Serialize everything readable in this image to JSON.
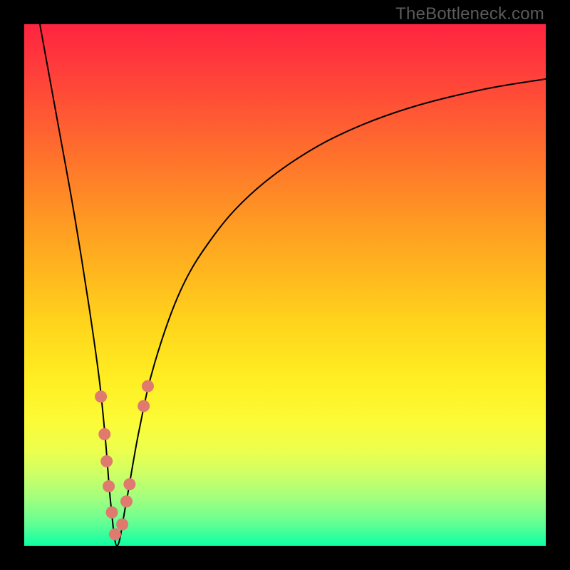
{
  "watermark": "TheBottleneck.com",
  "chart_data": {
    "type": "line",
    "title": "",
    "xlabel": "",
    "ylabel": "",
    "xlim": [
      0,
      100
    ],
    "ylim": [
      0,
      100
    ],
    "grid": false,
    "legend": false,
    "series": [
      {
        "name": "bottleneck-curve",
        "x": [
          3.0,
          5.0,
          7.0,
          9.0,
          11.0,
          13.0,
          14.5,
          15.6,
          16.6,
          17.8,
          19.5,
          22.0,
          25.0,
          30.0,
          36.0,
          43.0,
          52.0,
          62.0,
          74.0,
          88.0,
          100.0
        ],
        "y": [
          100.0,
          89.0,
          78.0,
          67.0,
          55.0,
          42.0,
          31.0,
          20.0,
          8.0,
          0.0,
          8.0,
          22.0,
          35.0,
          49.0,
          59.0,
          67.0,
          74.0,
          79.5,
          84.0,
          87.5,
          89.5
        ]
      }
    ],
    "markers": [
      {
        "name": "dot",
        "x": 14.7,
        "y": 28.6
      },
      {
        "name": "dot",
        "x": 15.4,
        "y": 21.4
      },
      {
        "name": "dot",
        "x": 15.8,
        "y": 16.2
      },
      {
        "name": "dot",
        "x": 16.2,
        "y": 11.4
      },
      {
        "name": "dot",
        "x": 16.8,
        "y": 6.4
      },
      {
        "name": "dot",
        "x": 17.4,
        "y": 2.2
      },
      {
        "name": "dot",
        "x": 18.8,
        "y": 4.1
      },
      {
        "name": "dot",
        "x": 19.6,
        "y": 8.5
      },
      {
        "name": "dot",
        "x": 20.2,
        "y": 11.8
      },
      {
        "name": "dot",
        "x": 22.9,
        "y": 26.8
      },
      {
        "name": "dot",
        "x": 23.7,
        "y": 30.6
      }
    ],
    "gradient_stops": [
      {
        "pos": 0,
        "color": "#FF2440"
      },
      {
        "pos": 50,
        "color": "#FFD61C"
      },
      {
        "pos": 80,
        "color": "#FCFB36"
      },
      {
        "pos": 100,
        "color": "#12FF9E"
      }
    ]
  },
  "colors": {
    "frame": "#000000",
    "curve": "#000000",
    "marker": "#E0796E",
    "watermark": "#5B5B5B"
  }
}
